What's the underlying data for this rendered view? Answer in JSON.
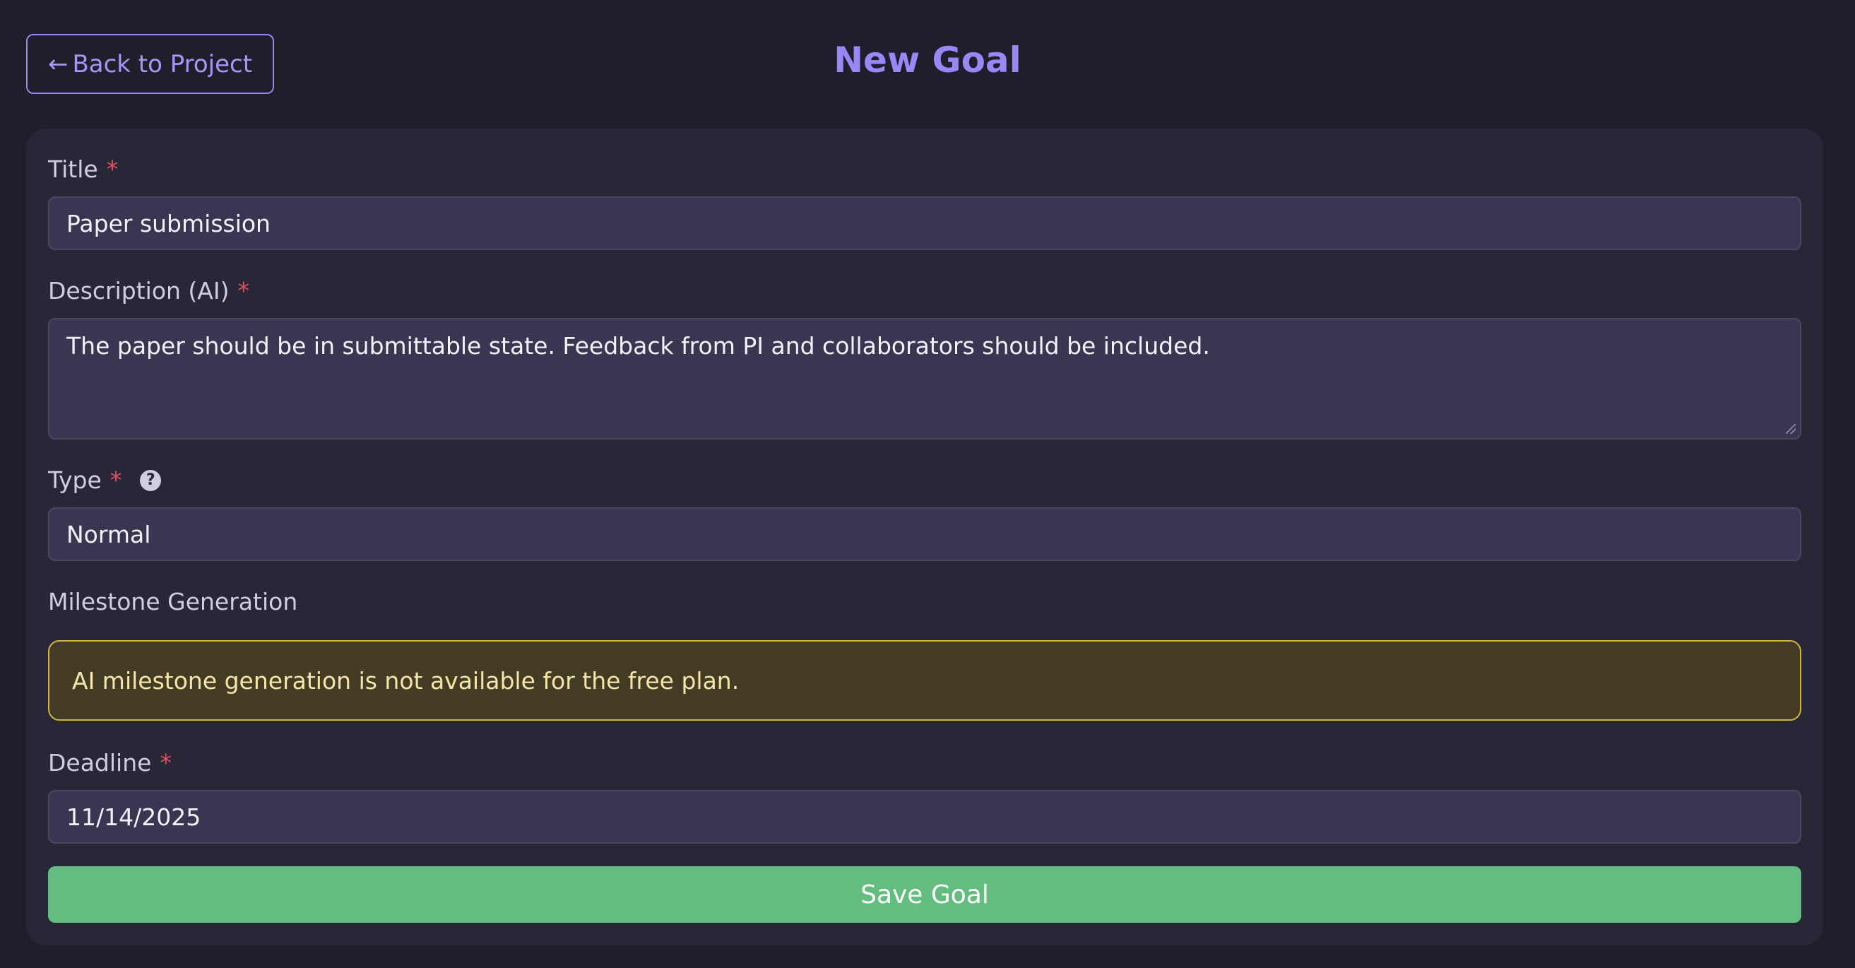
{
  "header": {
    "back_arrow": "←",
    "back_label": "Back to Project",
    "title": "New Goal"
  },
  "form": {
    "required_marker": "*",
    "title": {
      "label": "Title",
      "value": "Paper submission"
    },
    "description": {
      "label": "Description (AI)",
      "value": "The paper should be in submittable state. Feedback from PI and collaborators should be included."
    },
    "type": {
      "label": "Type",
      "help_glyph": "?",
      "value": "Normal"
    },
    "milestone": {
      "label": "Milestone Generation",
      "notice": "AI milestone generation is not available for the free plan."
    },
    "deadline": {
      "label": "Deadline",
      "value": "11/14/2025"
    },
    "save_label": "Save Goal"
  },
  "colors": {
    "background": "#1f1e2b",
    "card": "#282738",
    "accent": "#9b86f5",
    "required": "#e0515f",
    "input_bg": "#3a3652",
    "warning_bg": "#433b24",
    "warning_border": "#cdb444",
    "save": "#63bd7e"
  },
  "icons": {
    "back": "arrow-left-icon",
    "help": "question-circle-icon",
    "resize": "resize-grip-icon"
  }
}
